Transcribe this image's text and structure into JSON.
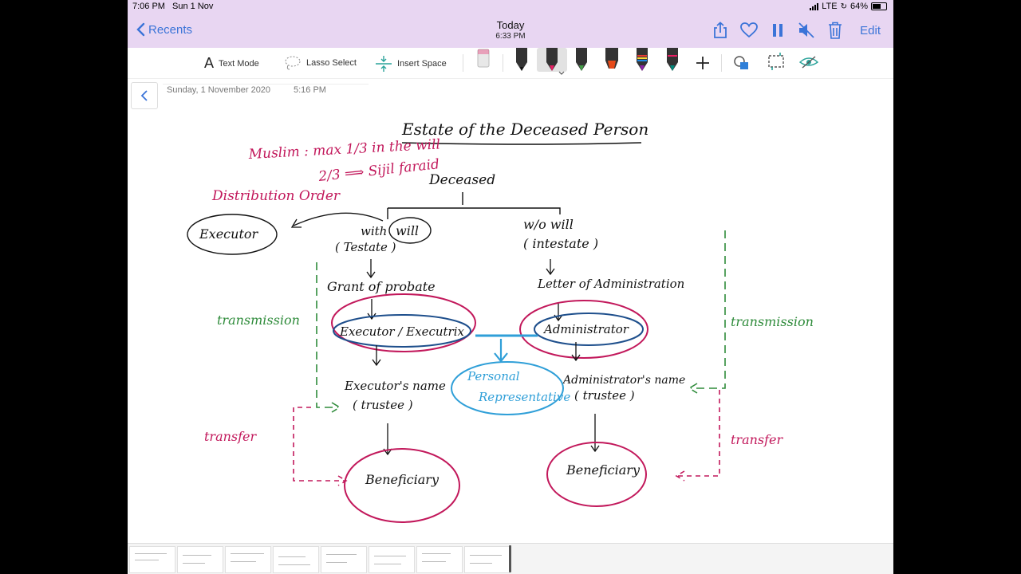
{
  "status_bar": {
    "time": "7:06 PM",
    "date": "Sun 1 Nov",
    "network": "LTE",
    "battery": "64%"
  },
  "nav": {
    "back_label": "Recents",
    "title": "Today",
    "subtitle": "6:33 PM",
    "icons": [
      "share-icon",
      "heart-icon",
      "pause-icon",
      "mute-icon",
      "trash-icon"
    ],
    "edit_label": "Edit"
  },
  "toolbar": {
    "text_mode": "Text Mode",
    "lasso": "Lasso Select",
    "insert_space": "Insert Space",
    "pens": [
      {
        "name": "eraser",
        "color": "#c8c8c8"
      },
      {
        "name": "black-pen",
        "color": "#111111"
      },
      {
        "name": "pink-pen",
        "color": "#c2185b"
      },
      {
        "name": "green-pen",
        "color": "#43a047"
      },
      {
        "name": "orange-highlighter",
        "color": "#e64a19"
      },
      {
        "name": "rainbow-pen",
        "color": "#8e24aa"
      },
      {
        "name": "blue-green-pen",
        "color": "#00897b"
      }
    ]
  },
  "page": {
    "date": "Sunday, 1 November 2020",
    "time": "5:16 PM"
  },
  "notes": {
    "title": "Estate of the Deceased Person",
    "muslim_line1": "Muslim : max 1/3 in the will",
    "muslim_line2": "2/3 ⟹ Sijil faraid",
    "distribution": "Distribution Order",
    "deceased": "Deceased",
    "with_will": "with",
    "will": "will",
    "testate": "( Testate )",
    "wo_will": "w/o will",
    "intestate": "( intestate )",
    "executor": "Executor",
    "grant_probate": "Grant of probate",
    "letter_admin": "Letter of Administration",
    "executor_executrix": "Executor / Executrix",
    "administrator": "Administrator",
    "personal": "Personal",
    "representative": "Representative",
    "transmission_left": "transmission",
    "transmission_right": "transmission",
    "executor_name": "Executor's name",
    "trustee_left": "( trustee )",
    "admin_name": "Administrator's name",
    "trustee_right": "( trustee )",
    "transfer_left": "transfer",
    "transfer_right": "transfer",
    "beneficiary_left": "Beneficiary",
    "beneficiary_right": "Beneficiary"
  },
  "colors": {
    "ink_black": "#111111",
    "ink_pink": "#c2185b",
    "ink_green": "#2e8b3a",
    "ink_blue": "#1e4f8c",
    "ink_cyan": "#2f9fd8",
    "accent": "#3b74d8",
    "bar_bg": "#e8d6f2"
  }
}
